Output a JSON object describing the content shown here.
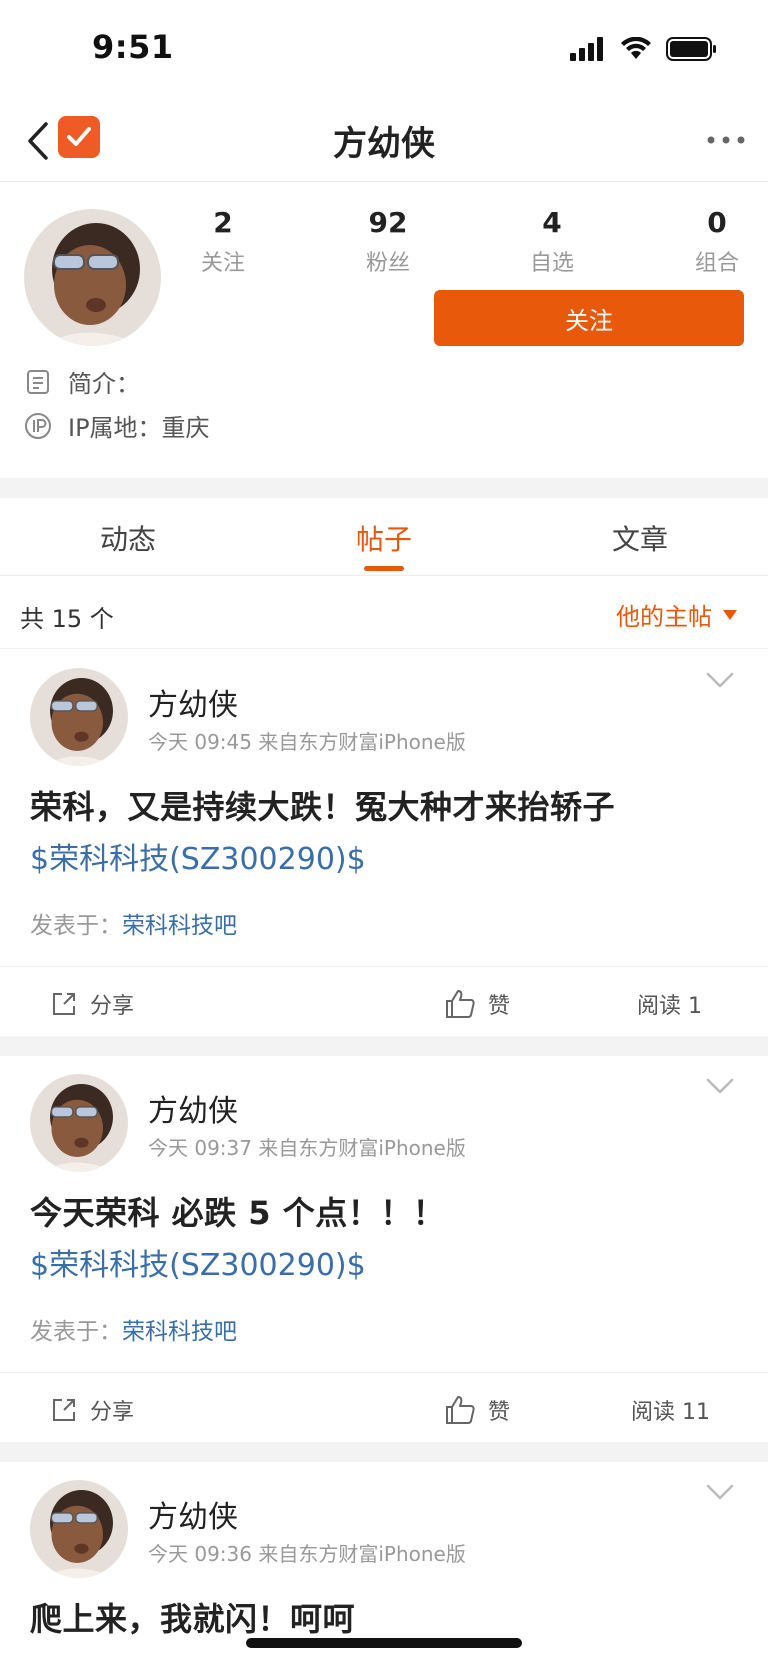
{
  "status_bar": {
    "time": "9:51"
  },
  "nav": {
    "title": "方幼侠"
  },
  "profile": {
    "stats": [
      {
        "value": "2",
        "label": "关注"
      },
      {
        "value": "92",
        "label": "粉丝"
      },
      {
        "value": "4",
        "label": "自选"
      },
      {
        "value": "0",
        "label": "组合"
      }
    ],
    "follow_label": "关注",
    "bio_label": "简介：",
    "ip_label": "IP属地：重庆"
  },
  "tabs": [
    {
      "label": "动态"
    },
    {
      "label": "帖子"
    },
    {
      "label": "文章"
    }
  ],
  "list": {
    "count": "共 15 个",
    "filter": "他的主帖"
  },
  "posts": [
    {
      "author": "方幼侠",
      "meta": "今天 09:45  来自东方财富iPhone版",
      "title": "荣科，又是持续大跌！冤大种才来抬轿子",
      "stock": "$荣科科技(SZ300290)$",
      "posted_prefix": "发表于：",
      "bar": "荣科科技吧",
      "share": "分享",
      "like": "赞",
      "read": "阅读  1"
    },
    {
      "author": "方幼侠",
      "meta": "今天 09:37  来自东方财富iPhone版",
      "title": "今天荣科 必跌 5 个点！！！",
      "stock": "$荣科科技(SZ300290)$",
      "posted_prefix": "发表于：",
      "bar": "荣科科技吧",
      "share": "分享",
      "like": "赞",
      "read": "阅读  11"
    },
    {
      "author": "方幼侠",
      "meta": "今天 09:36  来自东方财富iPhone版",
      "title": "爬上来，我就闪！呵呵"
    }
  ],
  "colors": {
    "accent": "#e8590c",
    "link": "#3a6ea8",
    "logo": "#f05a24"
  }
}
